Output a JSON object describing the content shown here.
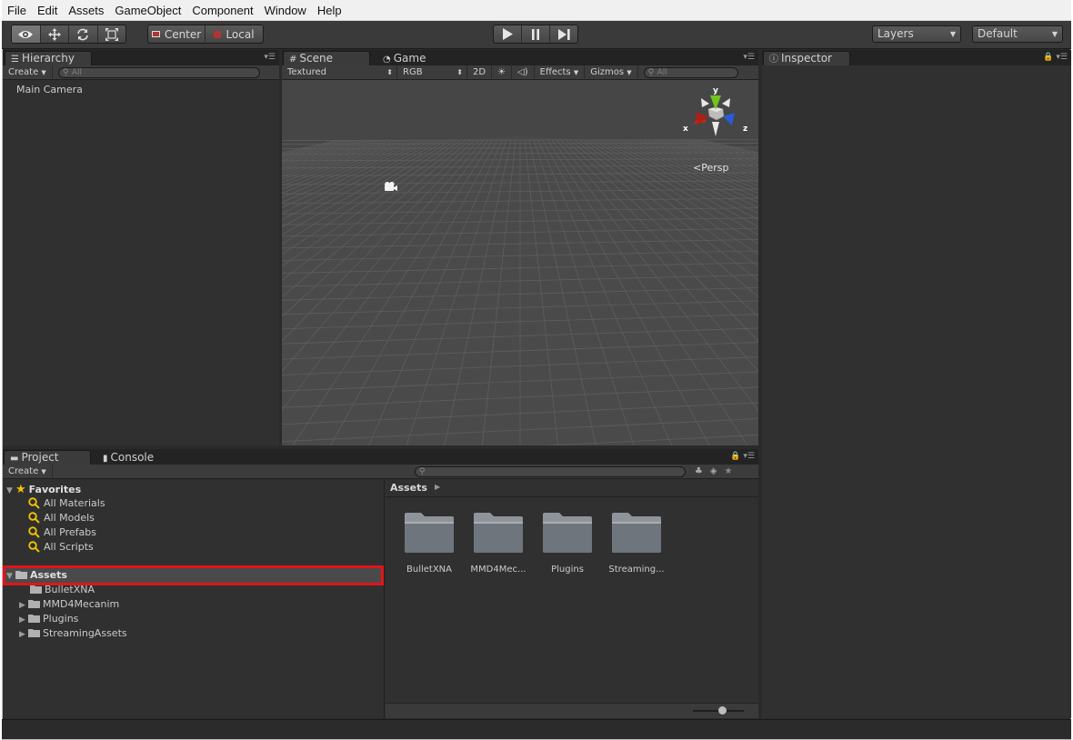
{
  "menu": [
    "File",
    "Edit",
    "Assets",
    "GameObject",
    "Component",
    "Window",
    "Help"
  ],
  "toolbar": {
    "pivot_label": "Center",
    "space_label": "Local",
    "layers_label": "Layers",
    "layout_label": "Default"
  },
  "hierarchy": {
    "tab_label": "Hierarchy",
    "create_label": "Create",
    "search_placeholder": "All",
    "items": [
      "Main Camera"
    ]
  },
  "scene": {
    "tab_label": "Scene",
    "game_tab_label": "Game",
    "shading_mode": "Textured",
    "render_mode": "RGB",
    "mode_2d": "2D",
    "effects_label": "Effects",
    "gizmos_label": "Gizmos",
    "search_placeholder": "All",
    "gizmo_axes": {
      "x": "x",
      "y": "y",
      "z": "z"
    },
    "projection_label": "Persp"
  },
  "inspector": {
    "tab_label": "Inspector"
  },
  "project": {
    "tab_label": "Project",
    "console_tab_label": "Console",
    "create_label": "Create",
    "favorites": {
      "label": "Favorites",
      "items": [
        "All Materials",
        "All Models",
        "All Prefabs",
        "All Scripts"
      ]
    },
    "assets": {
      "label": "Assets",
      "children": [
        "BulletXNA",
        "MMD4Mecanim",
        "Plugins",
        "StreamingAssets"
      ]
    },
    "breadcrumb": "Assets",
    "grid_items": [
      "BulletXNA",
      "MMD4Mec...",
      "Plugins",
      "Streaming..."
    ]
  },
  "colors": {
    "highlight": "#e2141a",
    "favorite_star": "#f2c500",
    "gizmo_x": "#cc2a1c",
    "gizmo_y": "#6fc51e",
    "gizmo_z": "#2a5bd6"
  }
}
